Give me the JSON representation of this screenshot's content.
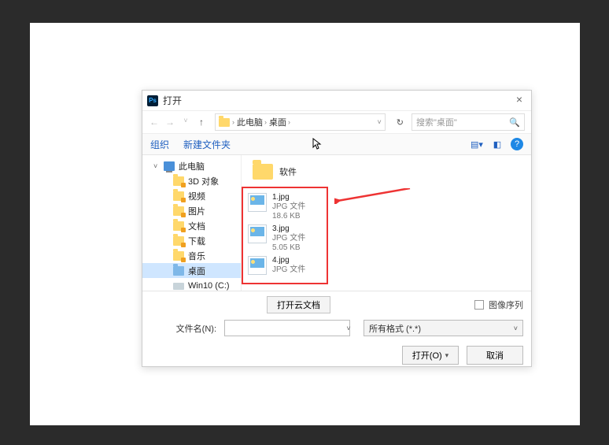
{
  "title": "打开",
  "path": {
    "seg1": "此电脑",
    "seg2": "桌面"
  },
  "search_placeholder": "搜索\"桌面\"",
  "toolbar": {
    "organize": "组织",
    "new_folder": "新建文件夹"
  },
  "sidebar": [
    {
      "label": "此电脑",
      "icon": "pc",
      "arrow": true
    },
    {
      "label": "3D 对象",
      "icon": "fld",
      "sub": true,
      "dot": true
    },
    {
      "label": "视频",
      "icon": "fld",
      "sub": true,
      "dot": true
    },
    {
      "label": "图片",
      "icon": "fld",
      "sub": true,
      "dot": true
    },
    {
      "label": "文档",
      "icon": "fld",
      "sub": true,
      "dot": true
    },
    {
      "label": "下载",
      "icon": "fld",
      "sub": true,
      "dot": true
    },
    {
      "label": "音乐",
      "icon": "fld",
      "sub": true,
      "dot": true
    },
    {
      "label": "桌面",
      "icon": "fld blue",
      "sub": true,
      "sel": true
    },
    {
      "label": "Win10 (C:)",
      "icon": "drv",
      "sub": true
    }
  ],
  "folder": {
    "name": "软件"
  },
  "files": [
    {
      "name": "1.jpg",
      "type": "JPG 文件",
      "size": "18.6 KB"
    },
    {
      "name": "3.jpg",
      "type": "JPG 文件",
      "size": "5.05 KB"
    },
    {
      "name": "4.jpg",
      "type": "JPG 文件",
      "size": ""
    }
  ],
  "cloud_btn": "打开云文档",
  "image_seq": "图像序列",
  "filename_label": "文件名(N):",
  "format_label": "所有格式 (*.*)",
  "open_btn": "打开(O)",
  "cancel_btn": "取消"
}
